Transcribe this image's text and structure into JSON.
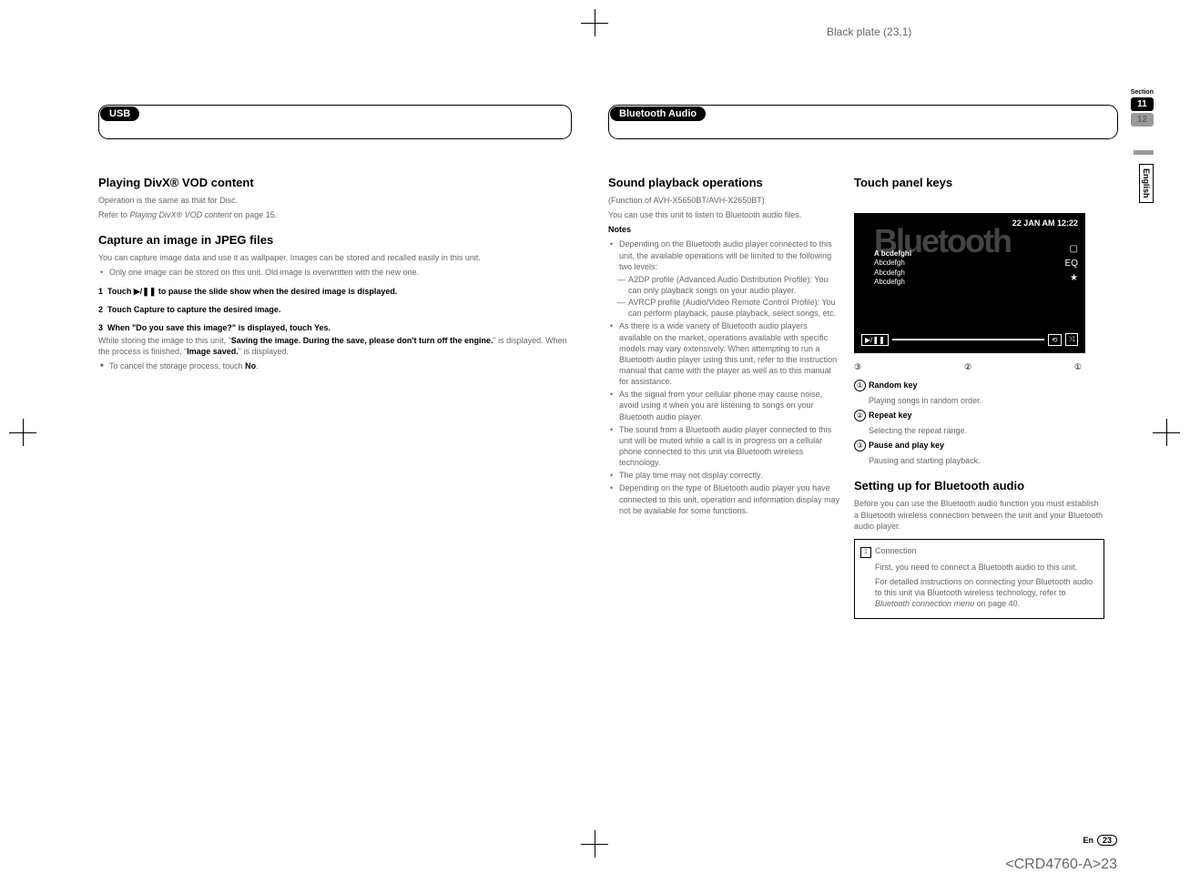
{
  "plate": "Black plate (23,1)",
  "section": {
    "label": "Section",
    "n11": "11",
    "n12": "12",
    "lang": "English"
  },
  "left": {
    "header": "USB",
    "h1": "Playing DivX® VOD content",
    "p1": "Operation is the same as that for Disc.",
    "p2a": "Refer to ",
    "p2i": "Playing DivX® VOD content",
    "p2b": " on page 15.",
    "h2": "Capture an image in JPEG files",
    "p3": "You can capture image data and use it as wallpaper. Images can be stored and recalled easily in this unit.",
    "b1": "Only one image can be stored on this unit. Old image is overwritten with the new one.",
    "s1n": "1",
    "s1": "Touch ▶/❚❚ to pause the slide show when the desired image is displayed.",
    "s2n": "2",
    "s2": "Touch Capture to capture the desired image.",
    "s3n": "3",
    "s3": "When \"Do you save this image?\" is displayed, touch Yes.",
    "p4a": "While storing the image to this unit, \"",
    "p4b": "Saving the image. During the save, please don't turn off the engine.",
    "p4c": "\" is displayed. When the process is finished, \"",
    "p4d": "Image saved.",
    "p4e": "\" is displayed.",
    "sq1a": "To cancel the storage process, touch ",
    "sq1b": "No",
    "sq1c": "."
  },
  "right": {
    "header": "Bluetooth Audio",
    "h1": "Sound playback operations",
    "p1": "(Function of AVH-X5650BT/AVH-X2650BT)",
    "p2": "You can use this unit to listen to Bluetooth audio files.",
    "notes": "Notes",
    "n1": "Depending on the Bluetooth audio player connected to this unit, the available operations will be limited to the following two levels:",
    "d1": "A2DP profile (Advanced Audio Distribution Profile): You can only playback songs on your audio player.",
    "d2": "AVRCP profile (Audio/Video Remote Control Profile): You can perform playback, pause playback, select songs, etc.",
    "n2": "As there is a wide variety of Bluetooth audio players available on the market, operations available with specific models may vary extensively. When attempting to run a Bluetooth audio player using this unit, refer to the instruction manual that came with the player as well as to this manual for assistance.",
    "n3": "As the signal from your cellular phone may cause noise, avoid using it when you are listening to songs on your Bluetooth audio player.",
    "n4": "The sound from a Bluetooth audio player connected to this unit will be muted while a call is in progress on a cellular phone connected to this unit via Bluetooth wireless technology.",
    "n5": "The play time may not display correctly.",
    "n6": "Depending on the type of Bluetooth audio player you have connected to this unit, operation and information display may not be available for some functions.",
    "h2": "Touch panel keys",
    "screen": {
      "word": "Bluetooth",
      "time": "22 JAN AM 12:22",
      "l1": "A bcdefghi",
      "l2": "Abcdefgh",
      "l3": "Abcdefgh",
      "l4": "Abcdefgh",
      "eq": "EQ",
      "star": "★"
    },
    "c1": "③",
    "c2": "②",
    "c3": "①",
    "k1n": "①",
    "k1t": "Random key",
    "k1d": "Playing songs in random order.",
    "k2n": "②",
    "k2t": "Repeat key",
    "k2d": "Selecting the repeat range.",
    "k3n": "③",
    "k3t": "Pause and play key",
    "k3d": "Pausing and starting playback.",
    "h3": "Setting up for Bluetooth audio",
    "p3": "Before you can use the Bluetooth audio function you must establish a Bluetooth wireless connection between the unit and your Bluetooth audio player.",
    "box": {
      "n": "1",
      "t": "Connection",
      "l1": "First, you need to connect a Bluetooth audio to this unit.",
      "l2a": "For detailed instructions on connecting your Bluetooth audio to this unit via Bluetooth wireless technology, refer to ",
      "l2i": "Bluetooth connection menu",
      "l2b": " on page 40."
    }
  },
  "footer": {
    "en": "En",
    "pn": "23"
  },
  "doc": "<CRD4760-A>23"
}
